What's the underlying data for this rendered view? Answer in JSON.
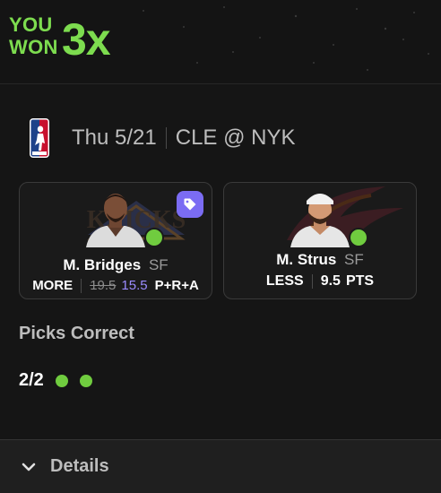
{
  "banner": {
    "line1": "YOU",
    "line2": "WON",
    "multiplier": "3x"
  },
  "game": {
    "league_icon": "nba-logo-icon",
    "date": "Thu 5/21",
    "matchup": "CLE @ NYK"
  },
  "picks": [
    {
      "name": "M. Bridges",
      "position": "SF",
      "direction": "MORE",
      "old_line": "19.5",
      "line": "15.5",
      "stat": "P+R+A",
      "result": "hit",
      "badge": "promo-tag-icon"
    },
    {
      "name": "M. Strus",
      "position": "SF",
      "direction": "LESS",
      "line": "9.5",
      "stat": "PTS",
      "result": "hit"
    }
  ],
  "summary": {
    "title": "Picks Correct",
    "count": "2/2"
  },
  "details": {
    "label": "Details"
  },
  "colors": {
    "accent_green": "#70cc3f",
    "promo_purple": "#7b6cf3",
    "background": "#151515"
  }
}
